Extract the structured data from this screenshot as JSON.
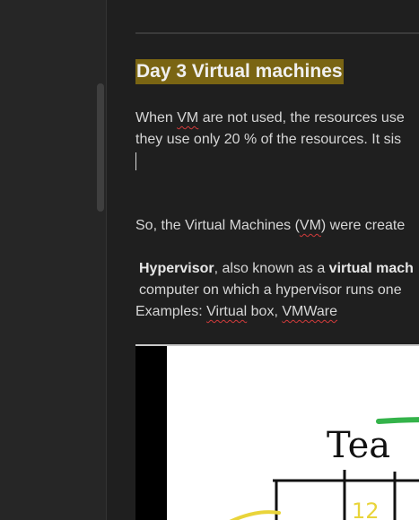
{
  "heading": "Day 3 Virtual machines",
  "line1": {
    "prefix": "When ",
    "vm": "VM",
    "suffix": " are not used, the resources use"
  },
  "line2": "they use only 20 % of the resources. It sis",
  "line3": {
    "prefix": "So, the Virtual Machines (",
    "vm": "VM",
    "suffix": ") were create"
  },
  "line4": {
    "term": "Hypervisor",
    "middle": ", also known as a ",
    "term2": "virtual mach"
  },
  "line5": "computer on which a hypervisor runs one",
  "line6": {
    "prefix": "Examples: ",
    "ex1a": "Virtual",
    "ex1b": " box, ",
    "ex2": "VMWare"
  },
  "image": {
    "handwritten_text": "Tea",
    "number": "12"
  },
  "colors": {
    "background": "#1f1f1f",
    "sidebar": "#262626",
    "heading_highlight": "#7a6513",
    "spellcheck": "#d23b3b"
  }
}
